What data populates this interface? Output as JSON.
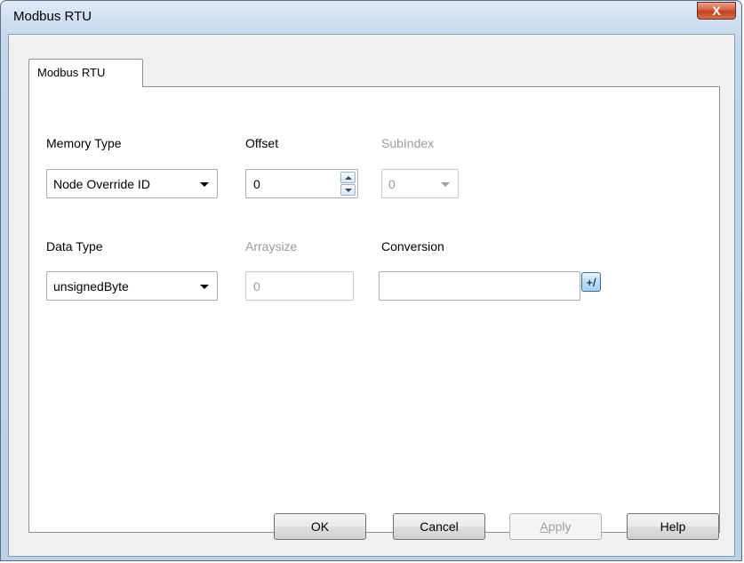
{
  "window": {
    "title": "Modbus RTU",
    "close_label": "X"
  },
  "tabs": [
    {
      "label": "Modbus RTU"
    }
  ],
  "form": {
    "memory_type": {
      "label": "Memory Type",
      "value": "Node Override ID"
    },
    "offset": {
      "label": "Offset",
      "value": "0"
    },
    "subindex": {
      "label": "SubIndex",
      "value": "0"
    },
    "data_type": {
      "label": "Data Type",
      "value": "unsignedByte"
    },
    "arraysize": {
      "label": "Arraysize",
      "value": "0"
    },
    "conversion": {
      "label": "Conversion",
      "value": "",
      "button_label": "+/"
    }
  },
  "buttons": {
    "ok": "OK",
    "cancel": "Cancel",
    "apply_first": "A",
    "apply_rest": "pply",
    "help": "Help"
  }
}
